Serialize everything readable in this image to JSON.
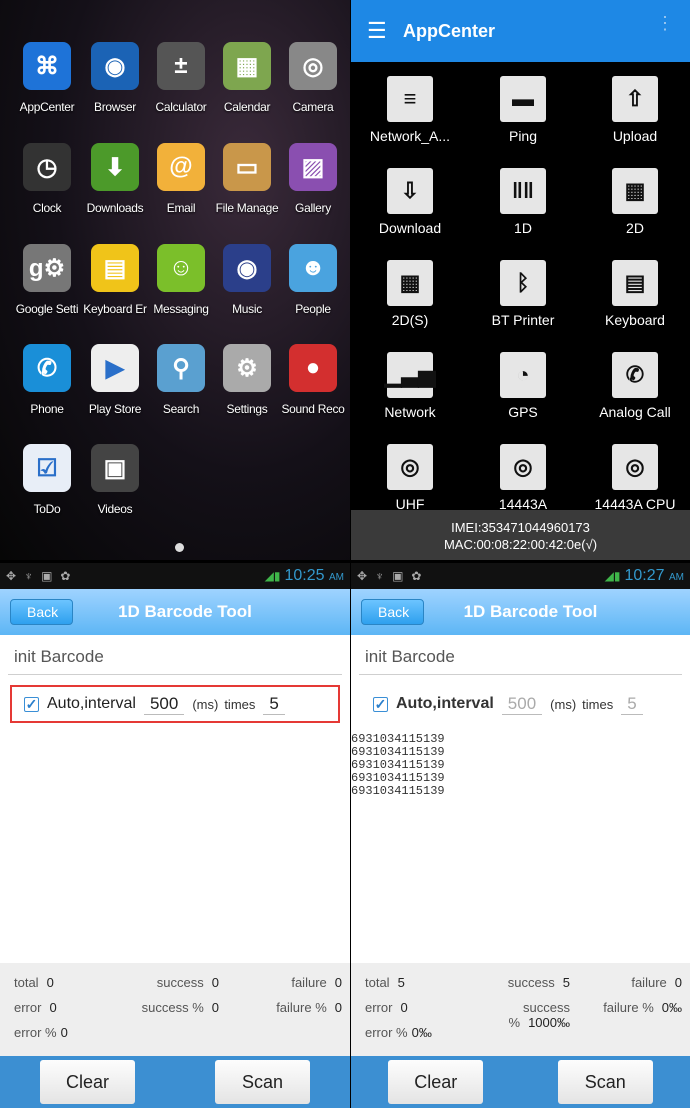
{
  "launcher": {
    "apps": [
      {
        "label": "AppCenter",
        "icon": "appcenter-icon",
        "color": "#1e73d8",
        "glyph": "⌘"
      },
      {
        "label": "Browser",
        "icon": "globe-icon",
        "color": "#1b63b5",
        "glyph": "◉"
      },
      {
        "label": "Calculator",
        "icon": "calculator-icon",
        "color": "#555555",
        "glyph": "±"
      },
      {
        "label": "Calendar",
        "icon": "calendar-icon",
        "color": "#7ea64f",
        "glyph": "▦"
      },
      {
        "label": "Camera",
        "icon": "camera-icon",
        "color": "#888888",
        "glyph": "◎"
      },
      {
        "label": "Clock",
        "icon": "clock-icon",
        "color": "#333333",
        "glyph": "◷"
      },
      {
        "label": "Downloads",
        "icon": "download-icon",
        "color": "#4c9a2a",
        "glyph": "⬇"
      },
      {
        "label": "Email",
        "icon": "email-icon",
        "color": "#f2b13a",
        "glyph": "@"
      },
      {
        "label": "File Manage",
        "icon": "folder-icon",
        "color": "#c9974a",
        "glyph": "▭"
      },
      {
        "label": "Gallery",
        "icon": "gallery-icon",
        "color": "#8a4fb0",
        "glyph": "▨"
      },
      {
        "label": "Google Setti",
        "icon": "google-settings-icon",
        "color": "#777777",
        "glyph": "g⚙"
      },
      {
        "label": "Keyboard Er",
        "icon": "keyboard-icon",
        "color": "#f0c419",
        "glyph": "▤"
      },
      {
        "label": "Messaging",
        "icon": "messaging-icon",
        "color": "#7bbf2a",
        "glyph": "☺"
      },
      {
        "label": "Music",
        "icon": "music-icon",
        "color": "#2b3f8a",
        "glyph": "◉"
      },
      {
        "label": "People",
        "icon": "people-icon",
        "color": "#4aa3df",
        "glyph": "☻"
      },
      {
        "label": "Phone",
        "icon": "phone-icon",
        "color": "#1a8fd8",
        "glyph": "✆"
      },
      {
        "label": "Play Store",
        "icon": "play-store-icon",
        "color": "#eeeeee",
        "glyph": "▶"
      },
      {
        "label": "Search",
        "icon": "search-icon",
        "color": "#5aa0d0",
        "glyph": "⚲"
      },
      {
        "label": "Settings",
        "icon": "gear-icon",
        "color": "#aaaaaa",
        "glyph": "⚙"
      },
      {
        "label": "Sound Reco",
        "icon": "microphone-icon",
        "color": "#d32f2f",
        "glyph": "●"
      },
      {
        "label": "ToDo",
        "icon": "todo-icon",
        "color": "#e8eef7",
        "glyph": "☑"
      },
      {
        "label": "Videos",
        "icon": "clapperboard-icon",
        "color": "#444444",
        "glyph": "▣"
      }
    ]
  },
  "appcenter": {
    "title": "AppCenter",
    "tiles": [
      {
        "label": "Network_A...",
        "icon": "network-a-icon",
        "glyph": "≡"
      },
      {
        "label": "Ping",
        "icon": "ping-icon",
        "glyph": "▬"
      },
      {
        "label": "Upload",
        "icon": "upload-icon",
        "glyph": "⇧"
      },
      {
        "label": "Download",
        "icon": "download-icon",
        "glyph": "⇩"
      },
      {
        "label": "1D",
        "icon": "barcode-1d-icon",
        "glyph": "‖‖"
      },
      {
        "label": "2D",
        "icon": "qr-code-icon",
        "glyph": "▦"
      },
      {
        "label": "2D(S)",
        "icon": "qr-code-s-icon",
        "glyph": "▦"
      },
      {
        "label": "BT Printer",
        "icon": "bluetooth-icon",
        "glyph": "ᛒ"
      },
      {
        "label": "Keyboard",
        "icon": "keyboard-icon",
        "glyph": "▤"
      },
      {
        "label": "Network",
        "icon": "signal-bars-icon",
        "glyph": "▁▃▅"
      },
      {
        "label": "GPS",
        "icon": "satellite-dish-icon",
        "glyph": "◔"
      },
      {
        "label": "Analog Call",
        "icon": "phone-call-icon",
        "glyph": "✆"
      },
      {
        "label": "UHF",
        "icon": "rfid-icon",
        "glyph": "◎"
      },
      {
        "label": "14443A",
        "icon": "rfid-icon",
        "glyph": "◎"
      },
      {
        "label": "14443A CPU",
        "icon": "rfid-icon",
        "glyph": "◎"
      }
    ],
    "imei": "IMEI:353471044960173",
    "mac": "MAC:00:08:22:00:42:0e(√)"
  },
  "tool1": {
    "time": "10:25",
    "ampm": "AM",
    "back": "Back",
    "title": "1D Barcode Tool",
    "init": "init Barcode",
    "auto_label": "Auto,interval",
    "interval": "500",
    "ms": "(ms)",
    "times_label": "times",
    "times": "5",
    "output": "",
    "stats": {
      "total_l": "total",
      "total": "0",
      "success_l": "success",
      "success": "0",
      "failure_l": "failure",
      "failure": "0",
      "error_l": "error",
      "error": "0",
      "success_pct_l": "success %",
      "success_pct": "0",
      "failure_pct_l": "failure %",
      "failure_pct": "0",
      "error_pct_l": "error %",
      "error_pct": "0"
    },
    "clear": "Clear",
    "scan": "Scan"
  },
  "tool2": {
    "time": "10:27",
    "ampm": "AM",
    "back": "Back",
    "title": "1D Barcode Tool",
    "init": "init Barcode",
    "auto_label": "Auto,interval",
    "interval": "500",
    "ms": "(ms)",
    "times_label": "times",
    "times": "5",
    "output": [
      "6931034115139",
      "6931034115139",
      "6931034115139",
      "6931034115139",
      "6931034115139"
    ],
    "stats": {
      "total_l": "total",
      "total": "5",
      "success_l": "success",
      "success": "5",
      "failure_l": "failure",
      "failure": "0",
      "error_l": "error",
      "error": "0",
      "success_pct_l": "success %",
      "success_pct": "1000‰",
      "failure_pct_l": "failure %",
      "failure_pct": "0‰",
      "error_pct_l": "error %",
      "error_pct": "0‰"
    },
    "clear": "Clear",
    "scan": "Scan"
  }
}
